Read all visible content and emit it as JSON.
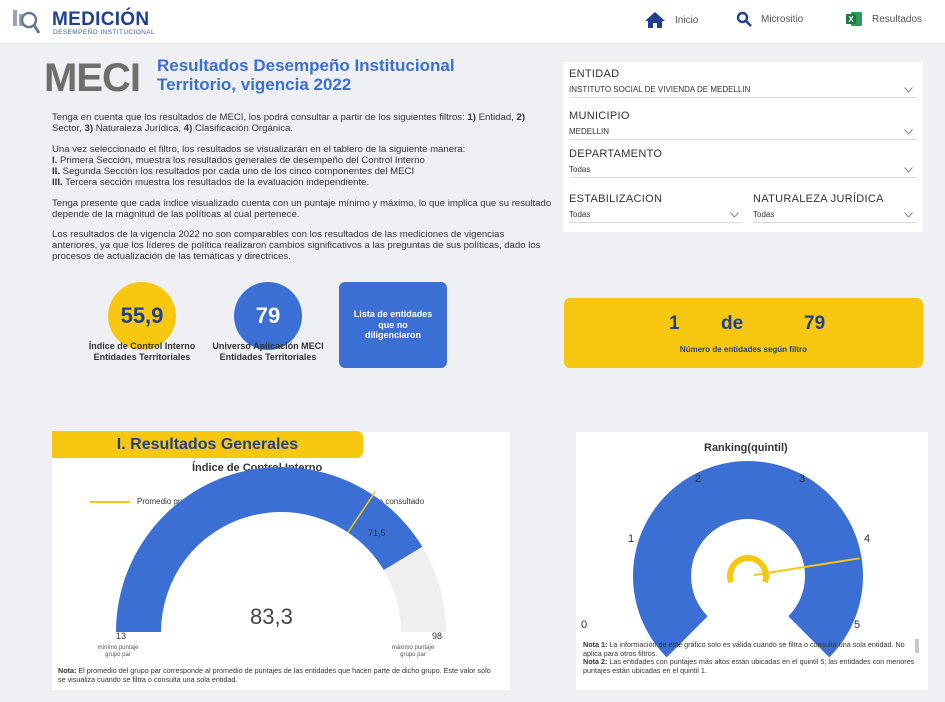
{
  "header": {
    "logo_title": "MEDICIÓN",
    "logo_subtitle": "DESEMPEÑO INSTITUCIONAL",
    "nav": [
      {
        "label": "Inicio",
        "icon": "home-icon"
      },
      {
        "label": "Micrositio",
        "icon": "search-icon"
      },
      {
        "label": "Resultados",
        "icon": "excel-icon"
      }
    ]
  },
  "intro": {
    "brand": "MECI",
    "title": "Resultados Desempeño Institucional Territorio, vigencia 2022",
    "p1_text": "Tenga en cuenta que los resultados de MECI, los podrá consultar a partir de los siguientes filtros:",
    "p1_f1_num": "1)",
    "p1_f1": "Entidad,",
    "p1_f2_num": "2)",
    "p1_f2": "Sector,",
    "p1_f3_num": "3)",
    "p1_f3": "Naturaleza Jurídica,",
    "p1_f4_num": "4)",
    "p1_f4": "Clasificación Orgánica.",
    "p2_lead": "Una vez seleccionado el filtro, los resultados se visualizarán en el tablero de la siguiente manera:",
    "p2_i_num": "I.",
    "p2_i": "Primera Sección, muestra los resultados generales de desempeño del Control Interno",
    "p2_ii_num": "II.",
    "p2_ii": "Segunda Sección los resultados por cada uno de los cinco componentes del MECI",
    "p2_iii_num": "III.",
    "p2_iii": "Tercera sección muestra los resultados de la evaluación independiente.",
    "p3": "Tenga presente que cada índice visualizado cuenta con un puntaje mínimo y máximo, lo que implica que su resultado depende de la magnitud de las políticas al cual pertenece.",
    "p4": "Los resultados de la vigencia 2022 no son comparables con los resultados de las mediciones de vigencias anteriores, ya que los líderes de política realizaron cambios significativos a las preguntas de sus políticas, dado los procesos de actualización de las temáticas y directrices."
  },
  "stats": {
    "indice_value": "55,9",
    "indice_label": "Índice de Control Interno Entidades Territoriales",
    "universo_value": "79",
    "universo_label": "Universo Aplicación MECI Entidades Territoriales",
    "list_button": "Lista de entidades que no diligenciaron",
    "colors": {
      "yellow": "#f7c80f",
      "blue": "#3b6fd4",
      "navy": "#1f3f8f"
    }
  },
  "filters": {
    "entidad_label": "ENTIDAD",
    "entidad_value": "INSTITUTO SOCIAL DE VIVIENDA DE MEDELLIN",
    "municipio_label": "MUNICIPIO",
    "municipio_value": "MEDELLIN",
    "departamento_label": "DEPARTAMENTO",
    "departamento_value": "Todas",
    "estabilizacion_label": "ESTABILIZACION",
    "estabilizacion_value": "Todas",
    "naturaleza_label": "NATURALEZA JURÍDICA",
    "naturaleza_value": "Todas"
  },
  "count": {
    "current": "1",
    "separator": "de",
    "total": "79",
    "label": "Número de entidades según filtro"
  },
  "section1": {
    "tag": "I. Resultados Generales",
    "chart_title": "Índice de Control Interno",
    "legend_avg": "Promedio grupo par",
    "legend_score": "Puntaje consultado",
    "value_label": "83,3",
    "avg_label": "71,5",
    "min_label": "13",
    "max_label": "98",
    "min_caption": "mínimo puntaje grupo par",
    "max_caption": "máximo puntaje grupo par",
    "note_bold": "Nota:",
    "note": "El promedio del grupo par corresponde al promedio de puntajes de las entidades que hacen parte de dicho grupo.  Este valor solo se visualiza cuando se filtra o consulta una sola entidad."
  },
  "ranking": {
    "title": "Ranking(quintil)",
    "labels": [
      "0",
      "1",
      "2",
      "3",
      "4",
      "5"
    ],
    "note1_bold": "Nota 1:",
    "note1": "La información de este gráfico solo es válida cuando se filtra o consulta una sola entidad. No aplica para otros filtros.",
    "note2_bold": "Nota 2:",
    "note2": "Las entidades con puntajes más altos están ubicadas en el quintil 5; las entidades con menores puntajes están ubicadas en el quintil 1."
  },
  "chart_data": [
    {
      "type": "gauge",
      "title": "Índice de Control Interno",
      "min": 13,
      "max": 98,
      "value": 83.3,
      "average": 71.5,
      "series": [
        {
          "name": "Puntaje consultado",
          "value": 83.3,
          "color": "#3b6fd4"
        },
        {
          "name": "Promedio grupo par",
          "value": 71.5,
          "color": "#f7c80f"
        }
      ]
    },
    {
      "type": "gauge",
      "title": "Ranking(quintil)",
      "min": 0,
      "max": 5,
      "value": 4,
      "ticks": [
        "0",
        "1",
        "2",
        "3",
        "4",
        "5"
      ]
    }
  ]
}
